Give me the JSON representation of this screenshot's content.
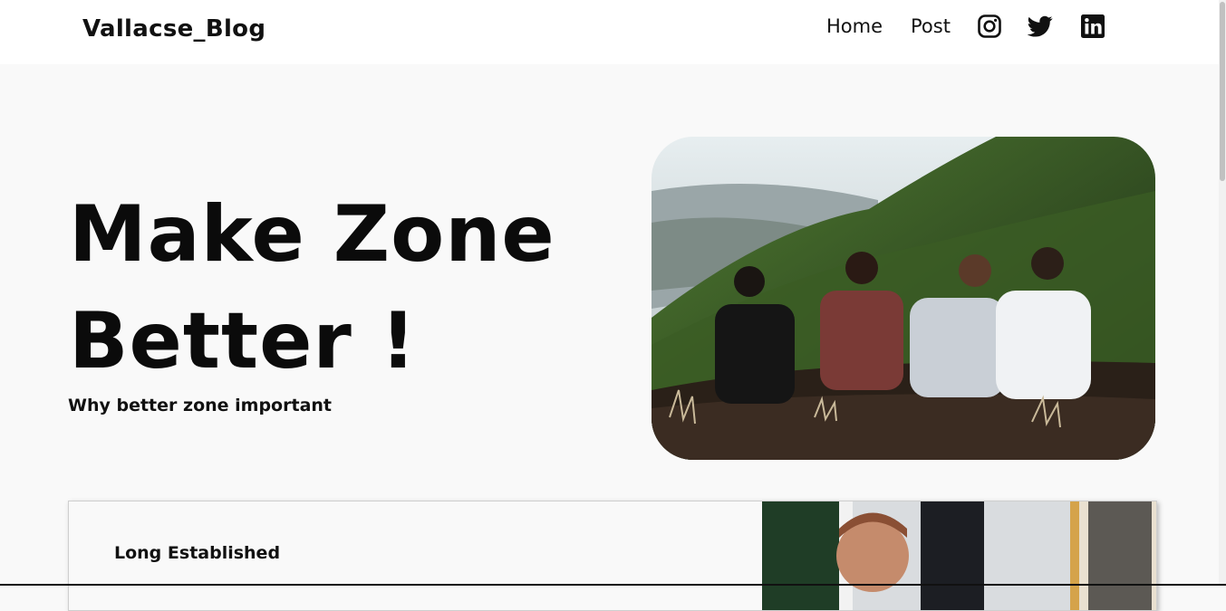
{
  "header": {
    "brand": "Vallacse_Blog",
    "nav": {
      "home": "Home",
      "post": "Post"
    },
    "social_icons": [
      "instagram-icon",
      "twitter-icon",
      "linkedin-icon"
    ]
  },
  "hero": {
    "title_line1": "Make Zone",
    "title_line2": "Better !",
    "subtitle": "Why better zone important",
    "image": "photo-four-friends-sitting-on-green-mountain"
  },
  "card": {
    "title": "Long Established",
    "image": "photo-man-in-office"
  },
  "colors": {
    "page_background": "#f9f9f9",
    "navbar_background": "#ffffff",
    "text": "#111111"
  }
}
